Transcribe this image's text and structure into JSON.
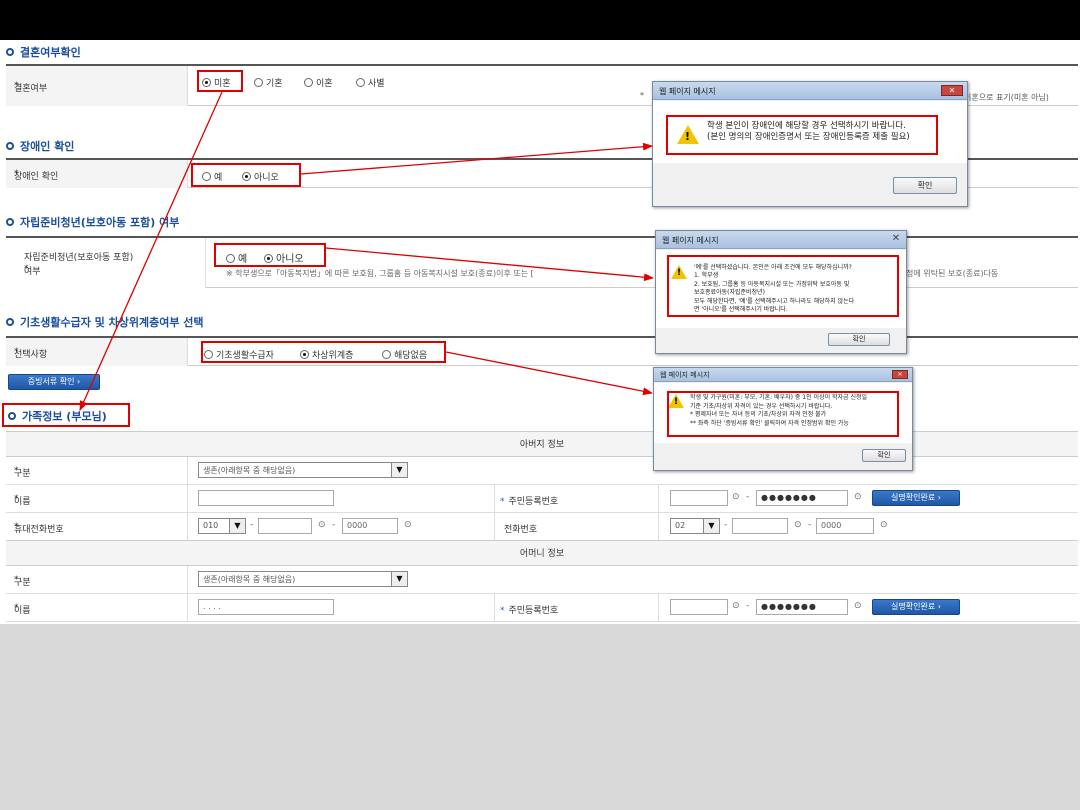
{
  "sections": {
    "marital": {
      "title": "결혼여부확인",
      "label": "결혼여부",
      "options": [
        "미혼",
        "기혼",
        "이혼",
        "사별"
      ],
      "note_prefix": "*",
      "note_suffix": "이혼으로 표기(미혼 아님)"
    },
    "disability": {
      "title": "장애인 확인",
      "label": "장애인 확인",
      "options": [
        "예",
        "아니오"
      ]
    },
    "independent": {
      "title": "자립준비청년(보호아동 포함) 여부",
      "label_line1": "자립준비청년(보호아동 포함)",
      "label_line2": "여부",
      "required_mark": "*",
      "options": [
        "예",
        "아니오"
      ],
      "note": "※ 학부생으로「아동복지법」에 따른 보호됨, 그룹홈 등 아동복지시설 보호(종료)이후 또는 [",
      "note_end": "정에 위탁된 보호(종료)다동"
    },
    "basic_living": {
      "title": "기초생활수급자 및 차상위계층여부 선택",
      "label": "선택사항",
      "options": [
        "기초생활수급자",
        "차상위계층",
        "해당없음"
      ]
    },
    "family": {
      "title": "가족정보 (부모님)"
    }
  },
  "proof_button": "증빙서류 확인",
  "father": {
    "header": "아버지 정보",
    "type_label": "구분",
    "type_value": "생존(아래항목 중 해당없음)",
    "name_label": "이름",
    "name_value": "",
    "rrn_label": "주민등록번호",
    "rrn_masked": "●●●●●●●",
    "verify_button": "실명확인완료",
    "mobile_label": "휴대전화번호",
    "mobile_prefix": "010",
    "mobile_last": "0000",
    "phone_label": "전화번호",
    "phone_prefix": "02",
    "phone_last": "0000"
  },
  "mother": {
    "header": "어머니 정보",
    "type_label": "구분",
    "type_value": "생존(아래항목 중 해당없음)",
    "name_label": "이름",
    "name_value": ". . . .",
    "rrn_label": "주민등록번호",
    "rrn_masked": "●●●●●●●",
    "verify_button": "실명확인완료"
  },
  "dialogs": {
    "d1": {
      "title": "웹 페이지 메시지",
      "close": "✕",
      "msg": [
        "학생 본인이 장애인에 해당할 경우 선택하시기 바랍니다.",
        "(본인 명의의 장애인증명서 또는 장애인등록증 제출 필요)"
      ],
      "ok": "확인"
    },
    "d2": {
      "title": "웹 페이지 메시지",
      "close": "✕",
      "msg": [
        "'예'를 선택하셨습니다. 본인은 아래 조건에 모두 해당하십니까?",
        "1. 학부생",
        "2. 보호됨, 그룹홈 등 아동복지시설 또는 가정위탁 보호아동 및",
        "보호종료아동(자립준비청년)",
        "모두 해당한다면, '예'를 선택해주시고 하나라도 해당하지 않는다",
        "면 '아니오'를 선택해주시기 바랍니다."
      ],
      "ok": "확인"
    },
    "d3": {
      "title": "웹 페이지 메시지",
      "close": "✕",
      "msg": [
        "학생 및 가구원(미혼: 부모, 기혼: 배우자) 중 1인 이상이 학자금 신청일",
        "기준 기초/차상위 자격이 있는 경우 선택하시기 바랍니다.",
        "* 평제자녀 또는 자녀 등의 기초/차상위 자격 인정 불가",
        "** 좌측 하단 '증빙서류 확인' 클릭하여 자격 인정범위 확인 가능"
      ],
      "ok": "확인"
    }
  },
  "colors": {
    "accent": "#1d4f9c",
    "highlight": "#e00000",
    "button": "#2a64b5"
  },
  "icons": [
    "warning-icon",
    "close-icon",
    "chevron-right-icon",
    "dropdown-arrow-icon",
    "calendar-icon"
  ]
}
